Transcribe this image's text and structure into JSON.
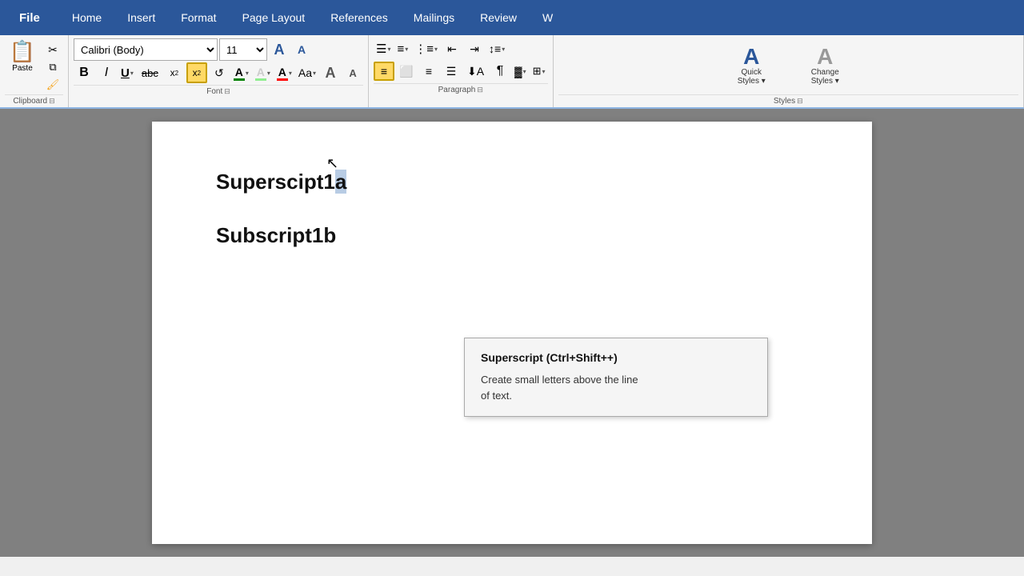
{
  "menu": {
    "file": "File",
    "home": "Home",
    "insert": "Insert",
    "format": "Format",
    "page_layout": "Page Layout",
    "references": "References",
    "mailings": "Mailings",
    "review": "Review",
    "more": "W"
  },
  "clipboard": {
    "label": "Clipboard",
    "paste": "Paste",
    "expand_icon": "⊞"
  },
  "font": {
    "label": "Font",
    "font_name": "Calibri (Body)",
    "font_size": "11",
    "bold": "B",
    "italic": "I",
    "underline": "U",
    "strikethrough": "abc",
    "subscript_label": "x₂",
    "superscript_label": "x²",
    "clear_format": "↺",
    "text_color_label": "A",
    "highlight_label": "A",
    "font_color_label": "A",
    "grow_label": "Aₐ",
    "shrink_label": "Aₐ",
    "expand_icon": "⊞"
  },
  "paragraph": {
    "label": "Paragraph",
    "bullets": "≡",
    "numbering": "≡",
    "multilevel": "≡",
    "decrease_indent": "⇤",
    "increase_indent": "⇥",
    "align_left": "≡",
    "align_center": "≡",
    "align_right": "≡",
    "justify": "≡",
    "line_spacing": "↕",
    "sort": "↕",
    "pilcrow": "¶",
    "shading": "▓",
    "borders": "⊞",
    "expand_icon": "⊞"
  },
  "styles": {
    "label": "Styles",
    "quick_styles": "Quick\nStyles",
    "change_styles": "Change\nStyles",
    "expand_icon": "⊞",
    "quick_styles_label": "Quick\nStyles ▾",
    "change_styles_label": "Change\nStyles ▾"
  },
  "tooltip": {
    "title": "Superscript (Ctrl+Shift++)",
    "description": "Create small letters above the line\nof text."
  },
  "document": {
    "superscript_text": "Superscipt1a",
    "subscript_text": "Subscript1b"
  },
  "colors": {
    "file_bg": "#2b579a",
    "accent": "#ffd966",
    "highlight_text": "#b8cce4",
    "underline_color": "green",
    "text_color": "red",
    "paragraph_active": "#ffd966"
  }
}
